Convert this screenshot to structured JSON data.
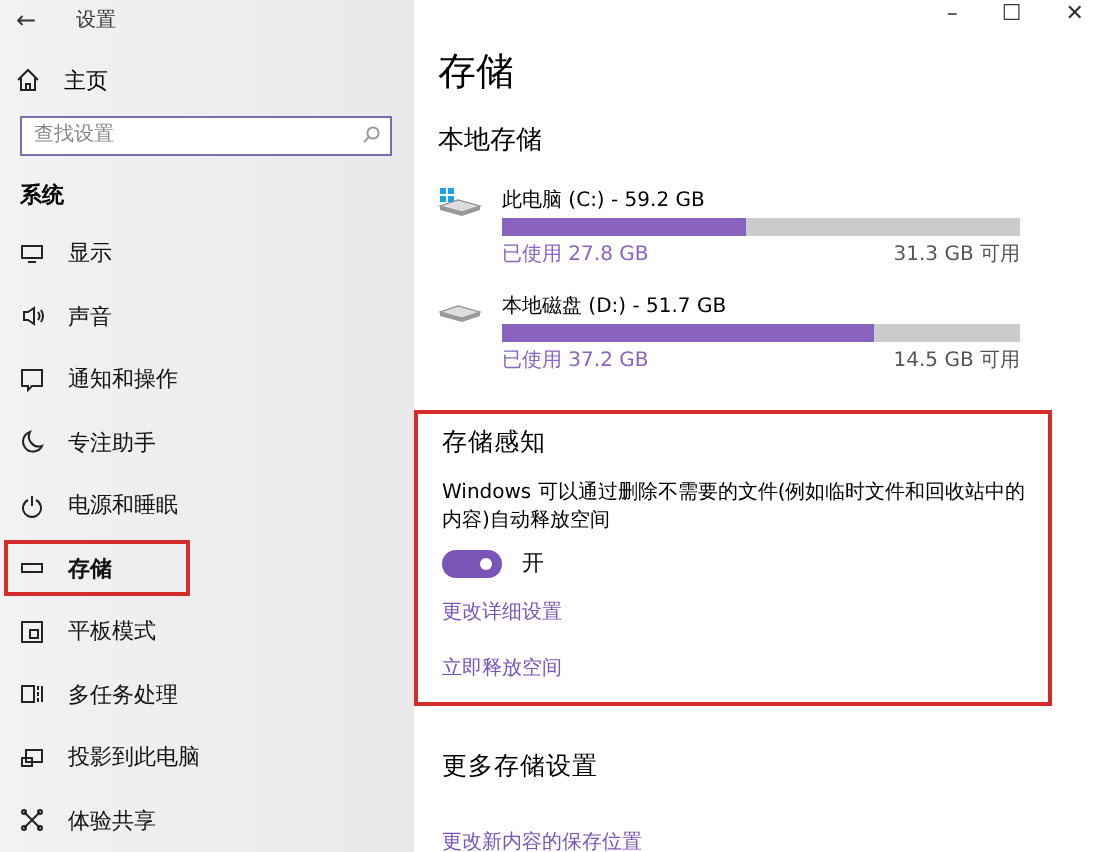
{
  "window": {
    "title": "设置",
    "back": "←",
    "controls": [
      "–",
      "☐",
      "✕"
    ]
  },
  "sidebar": {
    "home": "主页",
    "search": {
      "placeholder": "查找设置"
    },
    "section": "系统",
    "items": [
      {
        "label": "显示",
        "selected": false,
        "highlighted": false
      },
      {
        "label": "声音",
        "selected": false,
        "highlighted": false
      },
      {
        "label": "通知和操作",
        "selected": false,
        "highlighted": false
      },
      {
        "label": "专注助手",
        "selected": false,
        "highlighted": false
      },
      {
        "label": "电源和睡眠",
        "selected": false,
        "highlighted": false
      },
      {
        "label": "存储",
        "selected": true,
        "highlighted": true
      },
      {
        "label": "平板模式",
        "selected": false,
        "highlighted": false
      },
      {
        "label": "多任务处理",
        "selected": false,
        "highlighted": false
      },
      {
        "label": "投影到此电脑",
        "selected": false,
        "highlighted": false
      },
      {
        "label": "体验共享",
        "selected": false,
        "highlighted": false
      }
    ]
  },
  "main": {
    "title": "存储",
    "local_heading": "本地存储",
    "drives": [
      {
        "name": "此电脑 (C:) - 59.2 GB",
        "kind": "system",
        "level": 0.47,
        "used": "已使用 27.8 GB",
        "free": "31.3 GB 可用"
      },
      {
        "name": "本地磁盘 (D:) - 51.7 GB",
        "kind": "data",
        "level": 0.72,
        "used": "已使用 37.2 GB",
        "free": "14.5 GB 可用"
      }
    ],
    "storage_sense": {
      "highlighted": true,
      "heading": "存储感知",
      "description": "Windows 可以通过删除不需要的文件(例如临时文件和回收站中的内容)自动释放空间",
      "toggle": {
        "on": true,
        "label": "开"
      },
      "links": [
        "更改详细设置",
        "立即释放空间"
      ]
    },
    "more_heading": "更多存储设置",
    "more_links": [
      "更改新内容的保存位置"
    ]
  }
}
